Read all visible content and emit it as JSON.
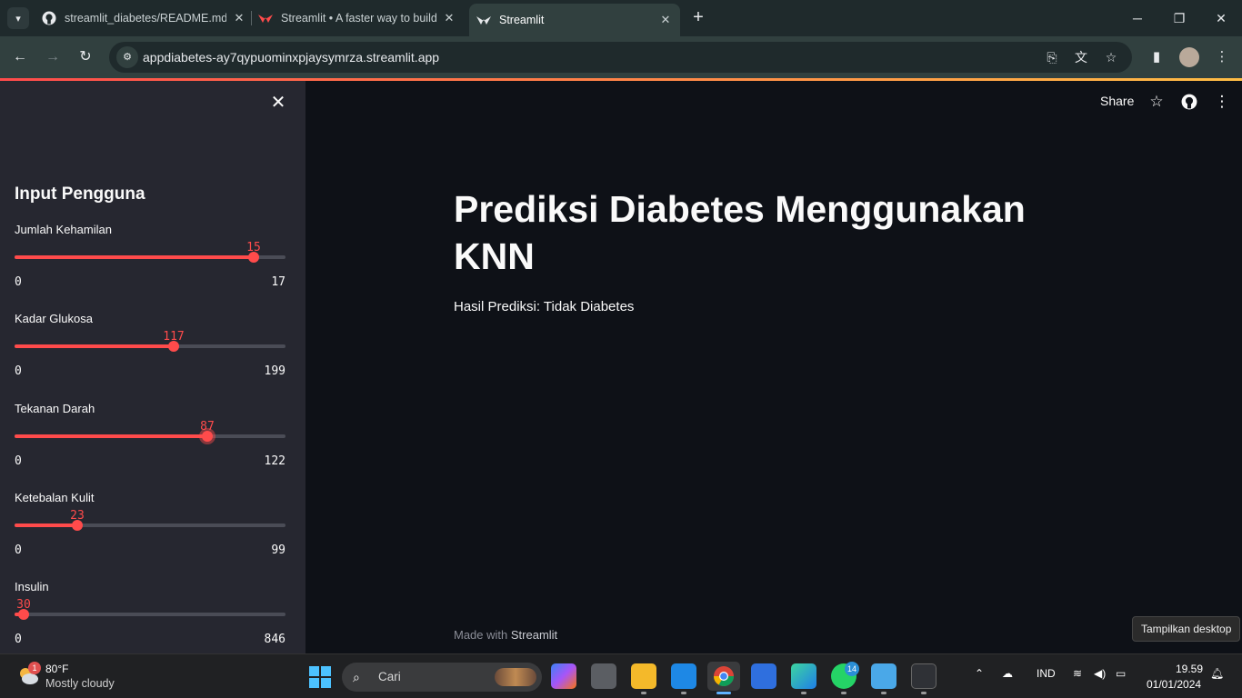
{
  "browser": {
    "tabs": [
      {
        "title": "streamlit_diabetes/README.md",
        "icon": "github-icon"
      },
      {
        "title": "Streamlit • A faster way to build",
        "icon": "streamlit-icon"
      },
      {
        "title": "Streamlit",
        "icon": "streamlit-icon"
      }
    ],
    "url": "appdiabetes-ay7qypuominxpjaysymrza.streamlit.app"
  },
  "sidebar": {
    "header": "Input Pengguna",
    "sliders": [
      {
        "label": "Jumlah Kehamilan",
        "value": "15",
        "min": "0",
        "max": "17",
        "fraction": 0.882
      },
      {
        "label": "Kadar Glukosa",
        "value": "117",
        "min": "0",
        "max": "199",
        "fraction": 0.588
      },
      {
        "label": "Tekanan Darah",
        "value": "87",
        "min": "0",
        "max": "122",
        "fraction": 0.713
      },
      {
        "label": "Ketebalan Kulit",
        "value": "23",
        "min": "0",
        "max": "99",
        "fraction": 0.232
      },
      {
        "label": "Insulin",
        "value": "30",
        "min": "0",
        "max": "846",
        "fraction": 0.035
      }
    ]
  },
  "main": {
    "title": "Prediksi Diabetes Menggunakan KNN",
    "result": "Hasil Prediksi: Tidak Diabetes",
    "share_label": "Share",
    "footer_prefix": "Made with ",
    "footer_brand": "Streamlit"
  },
  "tooltip": "Tampilkan desktop",
  "taskbar": {
    "weather_badge": "1",
    "temp": "80°F",
    "condition": "Mostly cloudy",
    "search_placeholder": "Cari",
    "whatsapp_badge": "14",
    "language": "IND",
    "time": "19.59",
    "date": "01/01/2024"
  },
  "colors": {
    "accent": "#ff4b4b",
    "sidebar_bg": "#262730",
    "main_bg": "#0e1117"
  }
}
